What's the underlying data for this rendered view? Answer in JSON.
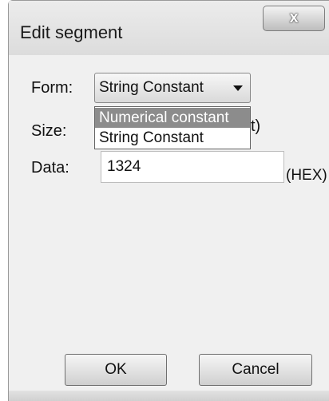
{
  "window": {
    "title": "Edit segment",
    "close_glyph": "x"
  },
  "form": {
    "form_label": "Form:",
    "form_value": "String Constant",
    "form_options": [
      "Numerical constant",
      "String Constant"
    ],
    "form_highlighted_option": "Numerical constant",
    "size_label": "Size:",
    "size_hidden_suffix": "t)",
    "data_label": "Data:",
    "data_value": "1324",
    "data_unit": "(HEX)"
  },
  "buttons": {
    "ok_label": "OK",
    "cancel_label": "Cancel"
  },
  "icons": {
    "close": "close-icon",
    "dropdown": "chevron-down-icon"
  }
}
